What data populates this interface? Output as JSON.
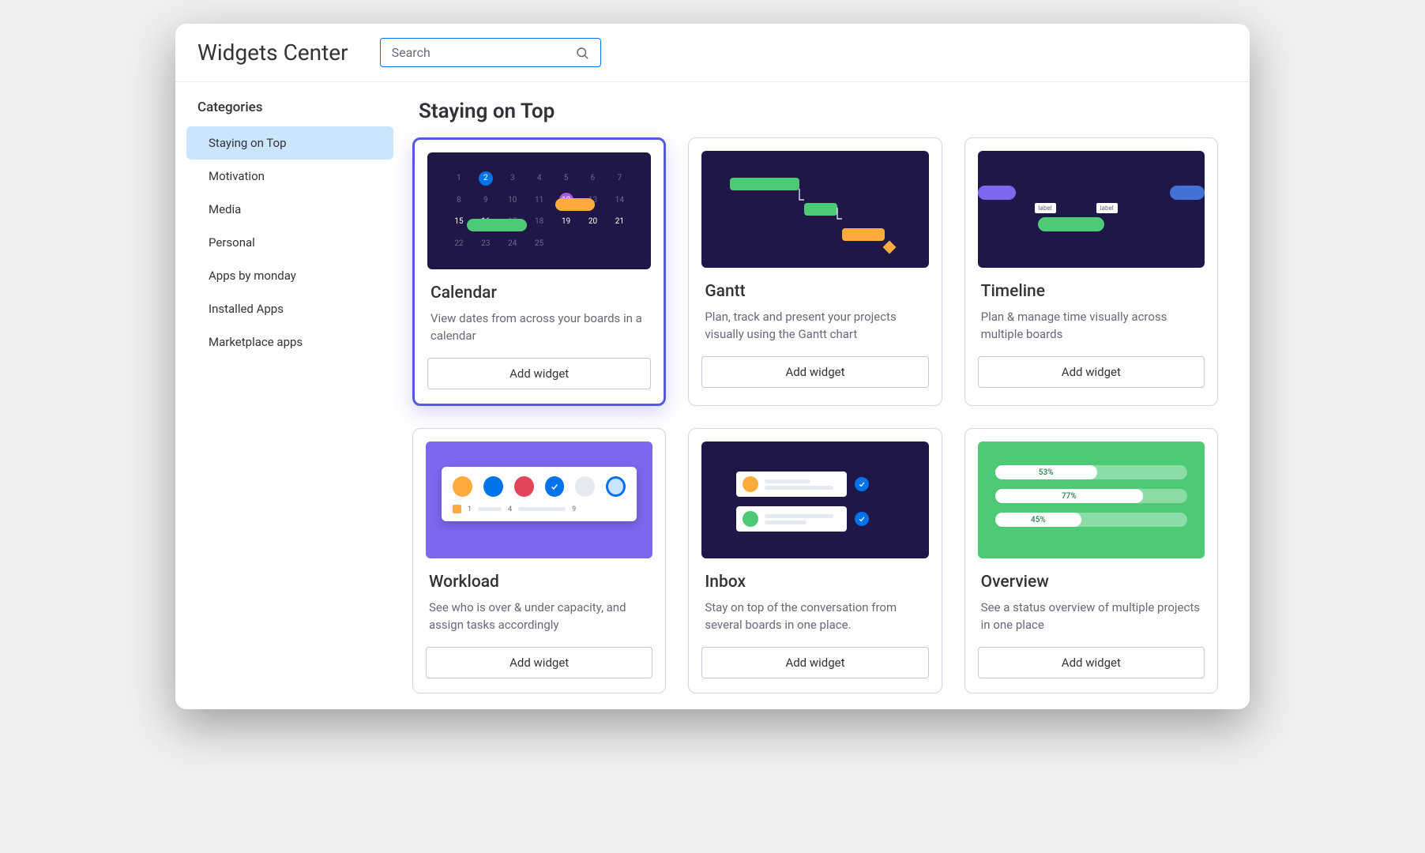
{
  "header": {
    "title": "Widgets Center"
  },
  "search": {
    "placeholder": "Search",
    "value": ""
  },
  "sidebar": {
    "heading": "Categories",
    "items": [
      {
        "label": "Staying on Top",
        "active": true
      },
      {
        "label": "Motivation",
        "active": false
      },
      {
        "label": "Media",
        "active": false
      },
      {
        "label": "Personal",
        "active": false
      },
      {
        "label": "Apps by monday",
        "active": false
      },
      {
        "label": "Installed Apps",
        "active": false
      },
      {
        "label": "Marketplace apps",
        "active": false
      }
    ]
  },
  "main": {
    "section_title": "Staying on Top",
    "add_widget_label": "Add widget",
    "cards": [
      {
        "id": "calendar",
        "title": "Calendar",
        "description": "View dates from across your boards in a calendar",
        "highlighted": true
      },
      {
        "id": "gantt",
        "title": "Gantt",
        "description": "Plan, track and present your projects visually using the Gantt chart",
        "highlighted": false
      },
      {
        "id": "timeline",
        "title": "Timeline",
        "description": "Plan & manage time visually across multiple boards",
        "highlighted": false
      },
      {
        "id": "workload",
        "title": "Workload",
        "description": "See who is over & under capacity, and assign tasks accordingly",
        "highlighted": false
      },
      {
        "id": "inbox",
        "title": "Inbox",
        "description": "Stay on top of the conversation from several boards in one place.",
        "highlighted": false
      },
      {
        "id": "overview",
        "title": "Overview",
        "description": "See a status overview of multiple projects in one place",
        "highlighted": false
      }
    ]
  },
  "thumbs": {
    "calendar": {
      "days": [
        "1",
        "2",
        "3",
        "4",
        "5",
        "6",
        "7",
        "8",
        "9",
        "10",
        "11",
        "12",
        "13",
        "14",
        "15",
        "16",
        "17",
        "18",
        "19",
        "20",
        "21",
        "22",
        "23",
        "24",
        "25"
      ],
      "blue_day": "2",
      "purple_day": "12",
      "yellow_range": [
        "15",
        "16"
      ],
      "green_range": [
        "19",
        "20",
        "21"
      ]
    },
    "overview": {
      "bars": [
        "53%",
        "77%",
        "45%"
      ]
    }
  },
  "colors": {
    "accent": "#5559df",
    "blue": "#0073ea",
    "green": "#4eca77",
    "yellow": "#fdab3d",
    "purple_bg": "#7b68ee",
    "dark_bg": "#1f1747"
  }
}
